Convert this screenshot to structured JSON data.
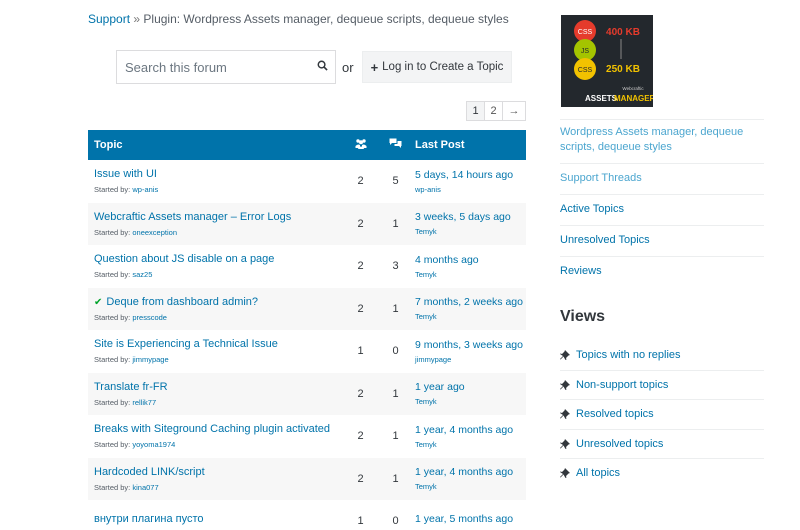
{
  "breadcrumb": {
    "support": "Support",
    "separator": "»",
    "current": "Plugin: Wordpress Assets manager, dequeue scripts, dequeue styles"
  },
  "search": {
    "placeholder": "Search this forum",
    "value": "",
    "icon": "search-icon"
  },
  "or_text": "or",
  "login_button": {
    "plus": "+",
    "label": "Log in to Create a Topic"
  },
  "pagination": {
    "pages": [
      "1",
      "2"
    ],
    "current": "1",
    "next": "→"
  },
  "table": {
    "headers": {
      "topic": "Topic",
      "voices_icon": "voices-icon",
      "posts_icon": "posts-icon",
      "last_post": "Last Post"
    },
    "rows": [
      {
        "title": "Issue with UI",
        "started_label": "Started by:",
        "started_by": "wp-anis",
        "voices": "2",
        "posts": "5",
        "last_time": "5 days, 14 hours ago",
        "last_author": "wp-anis",
        "resolved": false
      },
      {
        "title": "Webcraftic Assets manager – Error Logs",
        "started_label": "Started by:",
        "started_by": "oneexception",
        "voices": "2",
        "posts": "1",
        "last_time": "3 weeks, 5 days ago",
        "last_author": "Temyk",
        "resolved": false
      },
      {
        "title": "Question about JS disable on a page",
        "started_label": "Started by:",
        "started_by": "saz25",
        "voices": "2",
        "posts": "3",
        "last_time": "4 months ago",
        "last_author": "Temyk",
        "resolved": false
      },
      {
        "title": "Deque from dashboard admin?",
        "started_label": "Started by:",
        "started_by": "presscode",
        "voices": "2",
        "posts": "1",
        "last_time": "7 months, 2 weeks ago",
        "last_author": "Temyk",
        "resolved": true
      },
      {
        "title": "Site is Experiencing a Technical Issue",
        "started_label": "Started by:",
        "started_by": "jimmypage",
        "voices": "1",
        "posts": "0",
        "last_time": "9 months, 3 weeks ago",
        "last_author": "jimmypage",
        "resolved": false
      },
      {
        "title": "Translate fr-FR",
        "started_label": "Started by:",
        "started_by": "rellik77",
        "voices": "2",
        "posts": "1",
        "last_time": "1 year ago",
        "last_author": "Temyk",
        "resolved": false
      },
      {
        "title": "Breaks with Siteground Caching plugin activated",
        "started_label": "Started by:",
        "started_by": "yoyoma1974",
        "voices": "2",
        "posts": "1",
        "last_time": "1 year, 4 months ago",
        "last_author": "Temyk",
        "resolved": false
      },
      {
        "title": "Hardcoded LINK/script",
        "started_label": "Started by:",
        "started_by": "kina077",
        "voices": "2",
        "posts": "1",
        "last_time": "1 year, 4 months ago",
        "last_author": "Temyk",
        "resolved": false
      },
      {
        "title": "внутри плагина пусто",
        "started_label": "",
        "started_by": "",
        "voices": "1",
        "posts": "0",
        "last_time": "1 year, 5 months ago",
        "last_author": "",
        "resolved": false
      }
    ]
  },
  "plugin_logo": {
    "css_top": "CSS",
    "size_top": "400 KB",
    "js": "JS",
    "css_bottom": "CSS",
    "size_bottom": "250 KB",
    "brand": "Webcraftic",
    "caption_1": "ASSETS",
    "caption_2": "MANAGER",
    "colors": {
      "background": "#23282d",
      "red": "#e53b2c",
      "green": "#a4c400",
      "yellow": "#f2c200"
    }
  },
  "sidebar": {
    "plugin_name": "Wordpress Assets manager, dequeue scripts, dequeue styles",
    "items": [
      "Support Threads",
      "Active Topics",
      "Unresolved Topics",
      "Reviews"
    ]
  },
  "views": {
    "title": "Views",
    "items": [
      "Topics with no replies",
      "Non-support topics",
      "Resolved topics",
      "Unresolved topics",
      "All topics"
    ]
  },
  "colors": {
    "accent": "#0073aa",
    "text": "#32373c",
    "row_alt": "#f7f7f7"
  }
}
